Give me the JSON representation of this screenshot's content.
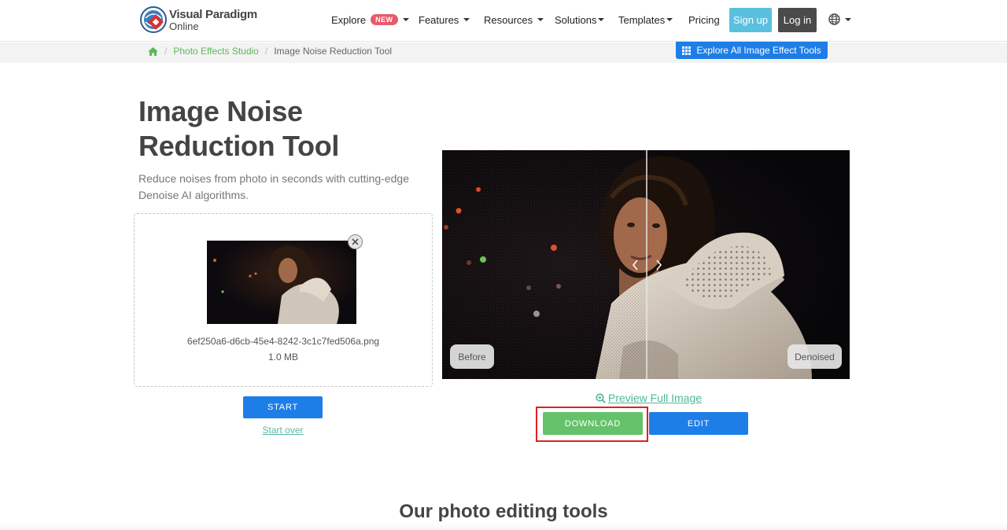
{
  "header": {
    "logo": {
      "line1": "Visual Paradigm",
      "line2": "Online"
    },
    "nav": [
      {
        "label": "Explore",
        "badge": "NEW"
      },
      {
        "label": "Features"
      },
      {
        "label": "Resources"
      },
      {
        "label": "Solutions"
      },
      {
        "label": "Templates"
      },
      {
        "label": "Pricing"
      }
    ],
    "signup_label": "Sign up",
    "login_label": "Log in"
  },
  "breadcrumb": {
    "items": [
      "Photo Effects Studio",
      "Image Noise Reduction Tool"
    ]
  },
  "explore_all_label": "Explore All Image Effect Tools",
  "main": {
    "title": "Image Noise Reduction Tool",
    "subtitle": "Reduce noises from photo in seconds with cutting-edge Denoise AI algorithms.",
    "file": {
      "name": "6ef250a6-d6cb-45e4-8242-3c1c7fed506a.png",
      "size": "1.0 MB"
    },
    "start_label": "START",
    "start_over_label": "Start over"
  },
  "compare": {
    "before_label": "Before",
    "after_label": "Denoised",
    "preview_label": "Preview Full Image",
    "download_label": "DOWNLOAD",
    "edit_label": "EDIT"
  },
  "section": {
    "title": "Our photo editing tools"
  },
  "colors": {
    "primary_blue": "#1e7ee8",
    "download_green": "#66c26a",
    "signup_cyan": "#5bc0de",
    "login_dark": "#4a4a4a",
    "link_green": "#5cb85c",
    "highlight_red": "#e02020"
  },
  "icons": [
    "home-icon",
    "grid-icon",
    "globe-icon",
    "close-icon",
    "zoom-icon",
    "chevron-left-icon",
    "chevron-right-icon"
  ]
}
